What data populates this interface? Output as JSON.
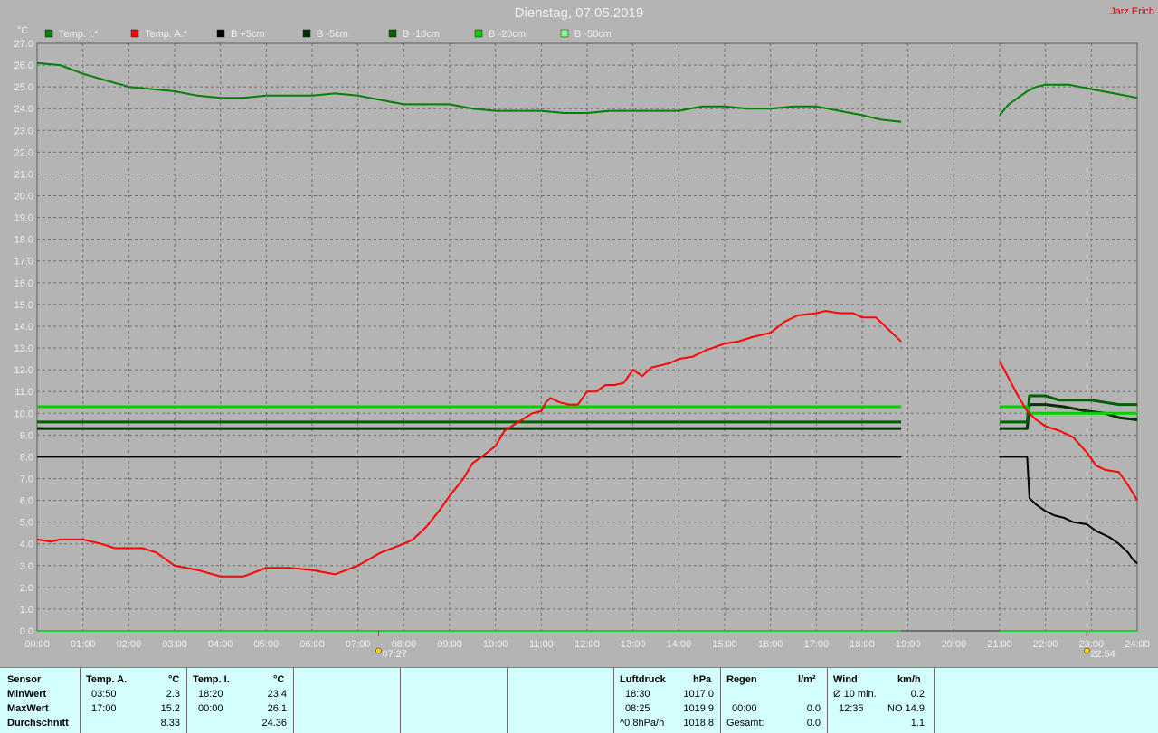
{
  "window": {
    "title": "Dienstag, 07.05.2019",
    "author": "Jarz Erich"
  },
  "colors": {
    "background": "#b4b4b4",
    "plot_background": "#b4b4b4",
    "grid": "#6e6e6e",
    "temp_i": "#008000",
    "temp_a": "#ff0000",
    "b_plus5": "#000000",
    "b_minus5": "#003000",
    "b_minus10": "#006000",
    "b_minus20": "#00d000",
    "b_minus50": "#80ff80",
    "stats_bg": "#d4ffff"
  },
  "chart_data": {
    "type": "line",
    "title": "Dienstag, 07.05.2019",
    "ylabel": "°C",
    "xlabel": "",
    "xlim": [
      0,
      24
    ],
    "ylim": [
      0,
      27
    ],
    "y_ticks": [
      "0.0",
      "1.0",
      "2.0",
      "3.0",
      "4.0",
      "5.0",
      "6.0",
      "7.0",
      "8.0",
      "9.0",
      "10.0",
      "11.0",
      "12.0",
      "13.0",
      "14.0",
      "15.0",
      "16.0",
      "17.0",
      "18.0",
      "19.0",
      "20.0",
      "21.0",
      "22.0",
      "23.0",
      "24.0",
      "25.0",
      "26.0",
      "27.0"
    ],
    "x_ticks": [
      "00:00",
      "01:00",
      "02:00",
      "03:00",
      "04:00",
      "05:00",
      "06:00",
      "07:00",
      "08:00",
      "09:00",
      "10:00",
      "11:00",
      "12:00",
      "13:00",
      "14:00",
      "15:00",
      "16:00",
      "17:00",
      "18:00",
      "19:00",
      "20:00",
      "21:00",
      "22:00",
      "23:00",
      "24:00"
    ],
    "grid": true,
    "legend_position": "top-left",
    "annotations": [
      {
        "x": 7.45,
        "label": "07:27",
        "icon": "sunrise-icon"
      },
      {
        "x": 22.9,
        "label": "22:54",
        "icon": "moonrise-icon"
      }
    ],
    "gap": [
      18.85,
      21.0
    ],
    "series": [
      {
        "name": "Temp. I.*",
        "color_key": "temp_i",
        "segments": [
          [
            [
              0,
              26.1
            ],
            [
              0.5,
              26.0
            ],
            [
              1,
              25.6
            ],
            [
              1.5,
              25.3
            ],
            [
              2,
              25.0
            ],
            [
              3,
              24.8
            ],
            [
              3.5,
              24.6
            ],
            [
              4,
              24.5
            ],
            [
              4.5,
              24.5
            ],
            [
              5,
              24.6
            ],
            [
              6,
              24.6
            ],
            [
              6.5,
              24.7
            ],
            [
              7,
              24.6
            ],
            [
              7.5,
              24.4
            ],
            [
              8,
              24.2
            ],
            [
              9,
              24.2
            ],
            [
              9.5,
              24.0
            ],
            [
              10,
              23.9
            ],
            [
              11,
              23.9
            ],
            [
              11.5,
              23.8
            ],
            [
              12,
              23.8
            ],
            [
              12.5,
              23.9
            ],
            [
              13,
              23.9
            ],
            [
              14,
              23.9
            ],
            [
              14.5,
              24.1
            ],
            [
              15,
              24.1
            ],
            [
              15.5,
              24.0
            ],
            [
              16,
              24.0
            ],
            [
              16.5,
              24.1
            ],
            [
              17,
              24.1
            ],
            [
              17.5,
              23.9
            ],
            [
              18,
              23.7
            ],
            [
              18.4,
              23.5
            ],
            [
              18.85,
              23.4
            ]
          ],
          [
            [
              21.0,
              23.7
            ],
            [
              21.2,
              24.2
            ],
            [
              21.4,
              24.5
            ],
            [
              21.6,
              24.8
            ],
            [
              21.8,
              25.0
            ],
            [
              22.0,
              25.1
            ],
            [
              22.5,
              25.1
            ],
            [
              23.0,
              24.9
            ],
            [
              23.5,
              24.7
            ],
            [
              24.0,
              24.5
            ]
          ]
        ]
      },
      {
        "name": "Temp. A.*",
        "color_key": "temp_a",
        "segments": [
          [
            [
              0,
              4.2
            ],
            [
              0.3,
              4.1
            ],
            [
              0.5,
              4.2
            ],
            [
              1,
              4.2
            ],
            [
              1.4,
              4.0
            ],
            [
              1.7,
              3.8
            ],
            [
              2,
              3.8
            ],
            [
              2.3,
              3.8
            ],
            [
              2.6,
              3.6
            ],
            [
              3,
              3.0
            ],
            [
              3.5,
              2.8
            ],
            [
              4,
              2.5
            ],
            [
              4.5,
              2.5
            ],
            [
              5,
              2.9
            ],
            [
              5.5,
              2.9
            ],
            [
              6,
              2.8
            ],
            [
              6.5,
              2.6
            ],
            [
              7,
              3.0
            ],
            [
              7.5,
              3.6
            ],
            [
              8,
              4.0
            ],
            [
              8.2,
              4.2
            ],
            [
              8.5,
              4.8
            ],
            [
              8.8,
              5.6
            ],
            [
              9,
              6.2
            ],
            [
              9.3,
              7.0
            ],
            [
              9.5,
              7.7
            ],
            [
              9.7,
              8.0
            ],
            [
              10,
              8.5
            ],
            [
              10.2,
              9.2
            ],
            [
              10.5,
              9.6
            ],
            [
              10.8,
              10.0
            ],
            [
              11,
              10.1
            ],
            [
              11.1,
              10.5
            ],
            [
              11.2,
              10.7
            ],
            [
              11.4,
              10.5
            ],
            [
              11.6,
              10.4
            ],
            [
              11.8,
              10.4
            ],
            [
              12,
              11.0
            ],
            [
              12.2,
              11.0
            ],
            [
              12.4,
              11.3
            ],
            [
              12.6,
              11.3
            ],
            [
              12.8,
              11.4
            ],
            [
              13,
              12.0
            ],
            [
              13.2,
              11.7
            ],
            [
              13.4,
              12.1
            ],
            [
              13.6,
              12.2
            ],
            [
              13.8,
              12.3
            ],
            [
              14,
              12.5
            ],
            [
              14.3,
              12.6
            ],
            [
              14.6,
              12.9
            ],
            [
              15,
              13.2
            ],
            [
              15.3,
              13.3
            ],
            [
              15.6,
              13.5
            ],
            [
              16,
              13.7
            ],
            [
              16.3,
              14.2
            ],
            [
              16.6,
              14.5
            ],
            [
              17,
              14.6
            ],
            [
              17.2,
              14.7
            ],
            [
              17.5,
              14.6
            ],
            [
              17.8,
              14.6
            ],
            [
              18,
              14.4
            ],
            [
              18.3,
              14.4
            ],
            [
              18.6,
              13.8
            ],
            [
              18.85,
              13.3
            ]
          ],
          [
            [
              21.0,
              12.4
            ],
            [
              21.2,
              11.6
            ],
            [
              21.4,
              10.8
            ],
            [
              21.6,
              10.1
            ],
            [
              21.8,
              9.7
            ],
            [
              22.0,
              9.4
            ],
            [
              22.3,
              9.2
            ],
            [
              22.6,
              8.9
            ],
            [
              22.9,
              8.2
            ],
            [
              23.1,
              7.6
            ],
            [
              23.3,
              7.4
            ],
            [
              23.6,
              7.3
            ],
            [
              23.8,
              6.7
            ],
            [
              24.0,
              6.0
            ]
          ]
        ]
      },
      {
        "name": "B +5cm",
        "color_key": "b_plus5",
        "segments": [
          [
            [
              0,
              8.0
            ],
            [
              18.85,
              8.0
            ]
          ],
          [
            [
              21.0,
              8.0
            ],
            [
              21.6,
              8.0
            ],
            [
              21.65,
              6.1
            ],
            [
              21.8,
              5.8
            ],
            [
              22.0,
              5.5
            ],
            [
              22.2,
              5.3
            ],
            [
              22.4,
              5.2
            ],
            [
              22.6,
              5.0
            ],
            [
              22.9,
              4.9
            ],
            [
              23.1,
              4.6
            ],
            [
              23.4,
              4.3
            ],
            [
              23.6,
              4.0
            ],
            [
              23.8,
              3.6
            ],
            [
              23.9,
              3.3
            ],
            [
              24.0,
              3.1
            ]
          ]
        ]
      },
      {
        "name": "B -5cm",
        "color_key": "b_minus5",
        "segments": [
          [
            [
              0,
              9.3
            ],
            [
              18.85,
              9.3
            ]
          ],
          [
            [
              21.0,
              9.3
            ],
            [
              21.6,
              9.3
            ],
            [
              21.65,
              10.4
            ],
            [
              22.0,
              10.4
            ],
            [
              22.4,
              10.3
            ],
            [
              22.9,
              10.1
            ],
            [
              23.3,
              10.0
            ],
            [
              23.6,
              9.8
            ],
            [
              24.0,
              9.7
            ]
          ]
        ]
      },
      {
        "name": "B -10cm",
        "color_key": "b_minus10",
        "segments": [
          [
            [
              0,
              9.6
            ],
            [
              18.85,
              9.6
            ]
          ],
          [
            [
              21.0,
              9.6
            ],
            [
              21.6,
              9.6
            ],
            [
              21.65,
              10.8
            ],
            [
              22.0,
              10.8
            ],
            [
              22.3,
              10.6
            ],
            [
              23.0,
              10.6
            ],
            [
              23.3,
              10.5
            ],
            [
              23.6,
              10.4
            ],
            [
              24.0,
              10.4
            ]
          ]
        ]
      },
      {
        "name": "B -20cm",
        "color_key": "b_minus20",
        "segments": [
          [
            [
              0,
              10.3
            ],
            [
              18.85,
              10.3
            ]
          ],
          [
            [
              21.0,
              10.3
            ],
            [
              21.6,
              10.3
            ],
            [
              21.65,
              10.0
            ],
            [
              24.0,
              10.0
            ]
          ]
        ]
      },
      {
        "name": "B -50cm",
        "color_key": "b_minus50",
        "segments": []
      }
    ]
  },
  "stats": {
    "sensor_header": "Sensor",
    "row_labels": [
      "MinWert",
      "MaxWert",
      "Durchschnitt"
    ],
    "temp_a": {
      "header": "Temp. A.",
      "unit": "°C",
      "min_time": "03:50",
      "min_value": "2.3",
      "max_time": "17:00",
      "max_value": "15.2",
      "avg": "8.33"
    },
    "temp_i": {
      "header": "Temp. I.",
      "unit": "°C",
      "min_time": "18:20",
      "min_value": "23.4",
      "max_time": "00:00",
      "max_value": "26.1",
      "avg": "24.36"
    },
    "pressure": {
      "header": "Luftdruck",
      "unit": "hPa",
      "min_time": "18:30",
      "min_value": "1017.0",
      "max_time": "08:25",
      "max_value": "1019.9",
      "trend_label": "^0.8hPa/h",
      "trend_value": "1018.8"
    },
    "rain": {
      "header": "Regen",
      "unit": "l/m²",
      "max_time": "00:00",
      "max_value": "0.0",
      "total_label": "Gesamt:",
      "total_value": "0.0"
    },
    "wind": {
      "header": "Wind",
      "unit": "km/h",
      "avg10_label": "Ø 10 min.",
      "avg10_value": "0.2",
      "max_time": "12:35",
      "max_value": "NO 14.9",
      "avg_value": "1.1"
    }
  }
}
